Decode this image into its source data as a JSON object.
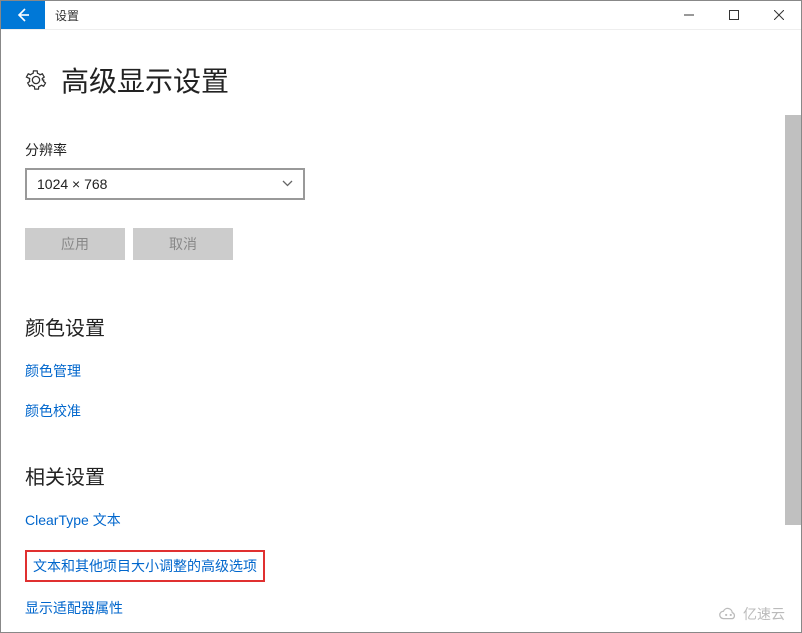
{
  "window": {
    "title": "设置"
  },
  "page": {
    "heading": "高级显示设置"
  },
  "resolution": {
    "label": "分辨率",
    "value": "1024 × 768"
  },
  "buttons": {
    "apply": "应用",
    "cancel": "取消"
  },
  "color_section": {
    "heading": "颜色设置",
    "link_manage": "颜色管理",
    "link_calibrate": "颜色校准"
  },
  "related_section": {
    "heading": "相关设置",
    "link_cleartype": "ClearType 文本",
    "link_textsize": "文本和其他项目大小调整的高级选项",
    "link_adapter": "显示适配器属性"
  },
  "watermark": "亿速云"
}
